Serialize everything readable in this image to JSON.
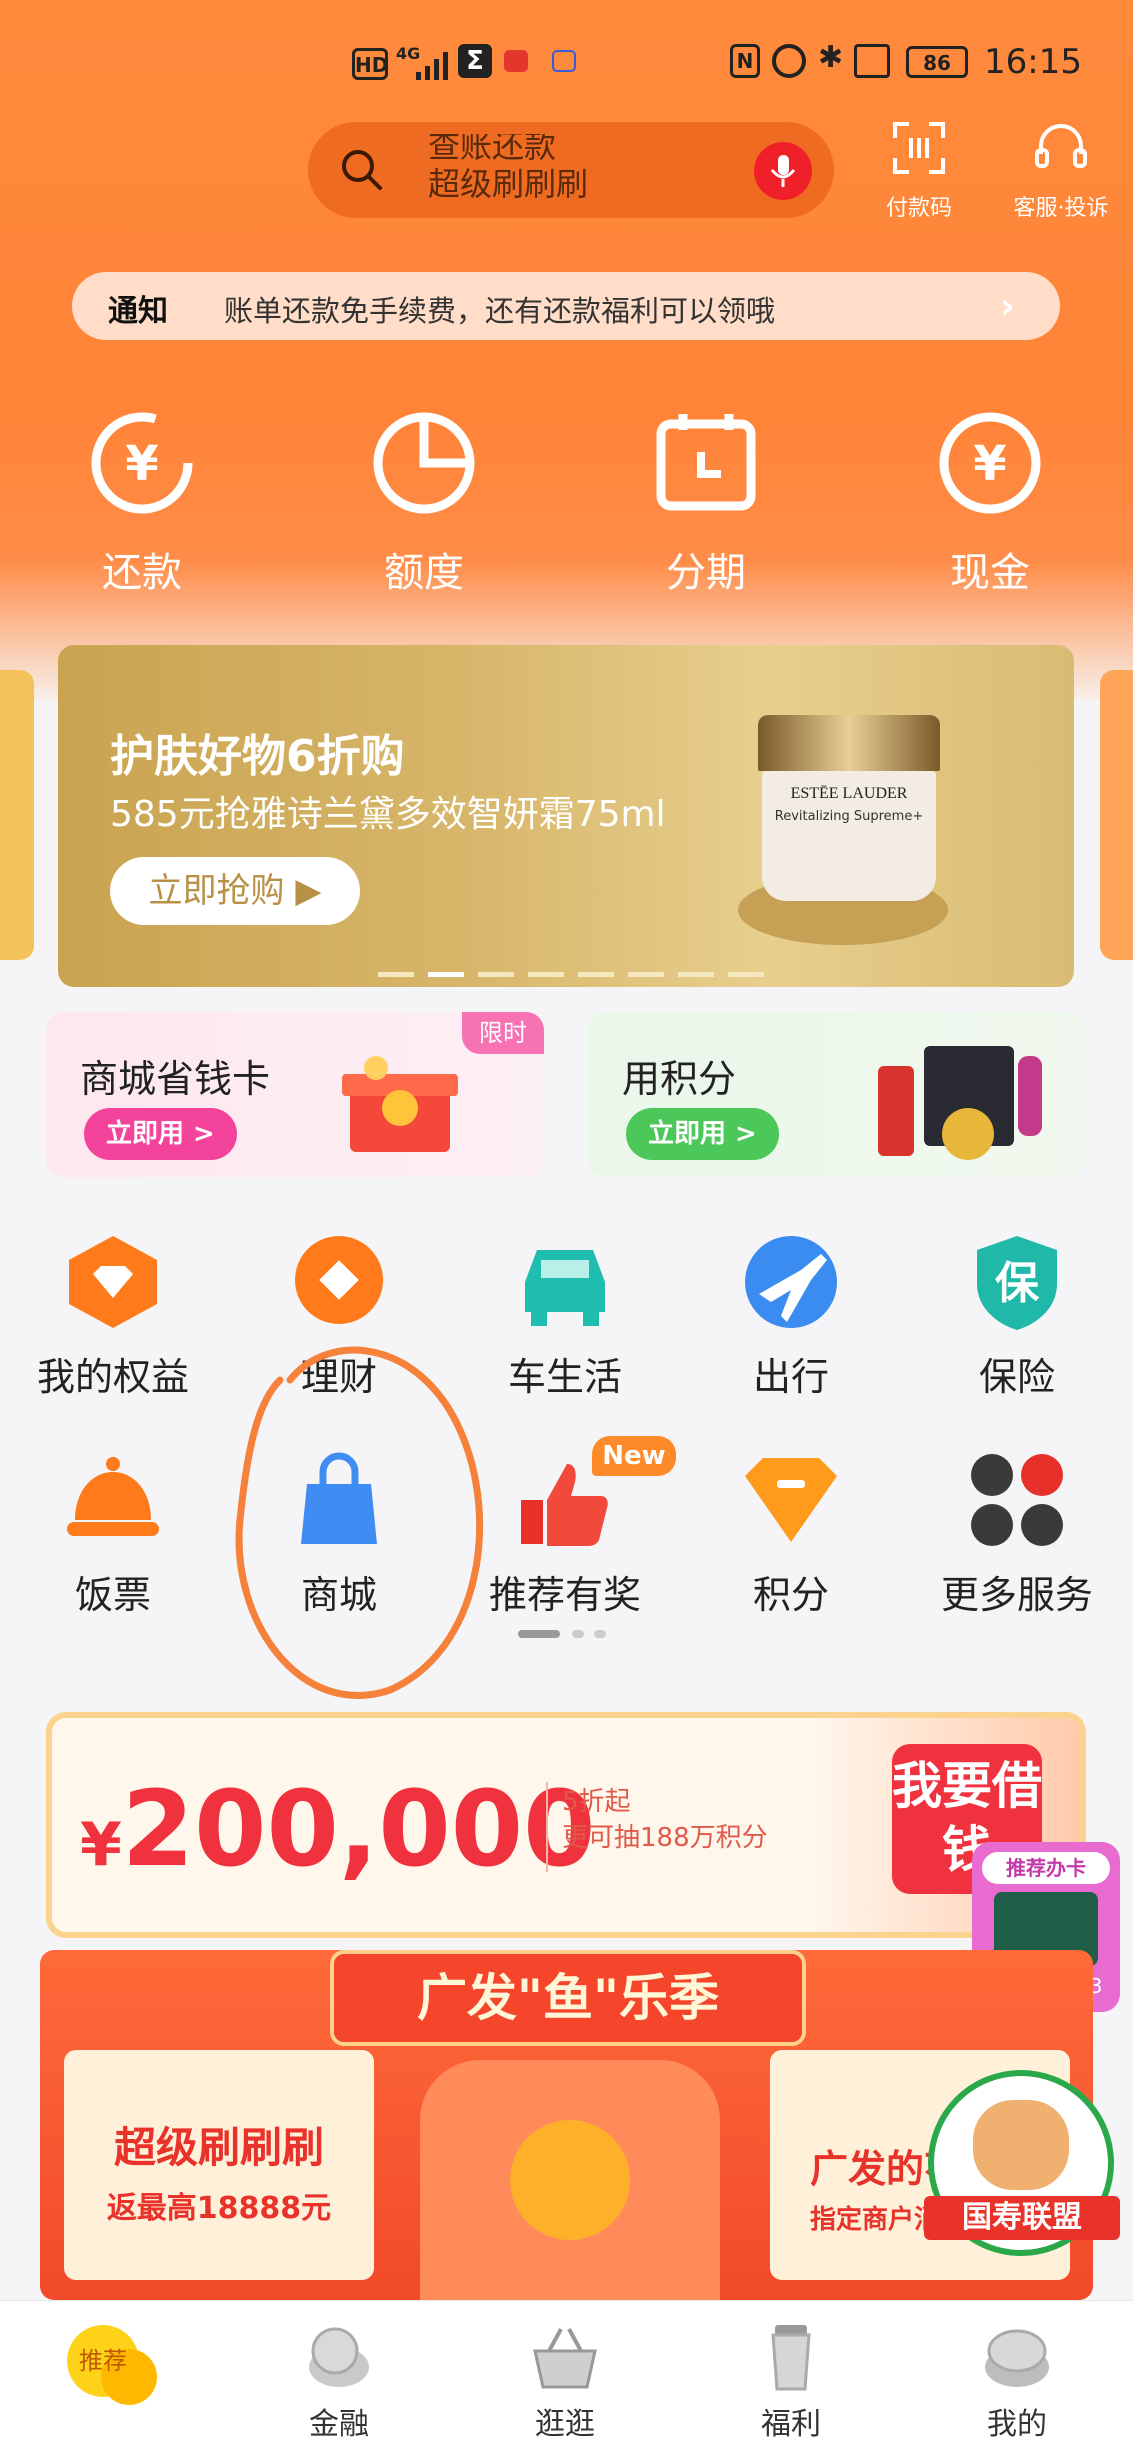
{
  "status_bar": {
    "left": [
      "HD",
      "4G"
    ],
    "battery": "86",
    "time": "16:15"
  },
  "header": {
    "search_text_line1": "查账还款",
    "search_text_line2": "超级刷刷刷",
    "pay_code_label": "付款码",
    "service_label": "客服·投诉"
  },
  "notice": {
    "tag": "通知",
    "text": "账单还款免手续费，还有还款福利可以领哦"
  },
  "quick_actions": [
    {
      "label": "还款",
      "icon": "repay-yen-icon"
    },
    {
      "label": "额度",
      "icon": "pie-chart-icon"
    },
    {
      "label": "分期",
      "icon": "calendar-icon"
    },
    {
      "label": "现金",
      "icon": "cash-yen-icon"
    }
  ],
  "banner": {
    "title": "护肤好物6折购",
    "subtitle": "585元抢雅诗兰黛多效智妍霜75ml",
    "button": "立即抢购",
    "product_brand": "ESTĒE LAUDER",
    "product_name": "Revitalizing Supreme+"
  },
  "promo_cards": [
    {
      "title": "商城省钱卡",
      "button": "立即用 >",
      "badge": "限时"
    },
    {
      "title": "用积分",
      "button": "立即用 >"
    }
  ],
  "services": [
    {
      "label": "我的权益",
      "icon": "benefits-diamond-icon"
    },
    {
      "label": "理财",
      "icon": "wealth-coin-icon"
    },
    {
      "label": "车生活",
      "icon": "car-icon"
    },
    {
      "label": "出行",
      "icon": "plane-icon"
    },
    {
      "label": "保险",
      "icon": "insurance-shield-icon"
    },
    {
      "label": "饭票",
      "icon": "dining-bell-icon"
    },
    {
      "label": "商城",
      "icon": "shopping-bag-icon"
    },
    {
      "label": "推荐有奖",
      "icon": "thumbs-up-icon",
      "badge": "New"
    },
    {
      "label": "积分",
      "icon": "points-gem-icon"
    },
    {
      "label": "更多服务",
      "icon": "more-grid-icon"
    }
  ],
  "loan": {
    "amount": "200,000",
    "currency": "¥",
    "sub_line1": "5折起",
    "sub_line2": "更可抽188万积分",
    "cta": "我要借钱"
  },
  "floating_card": {
    "top": "推荐办卡",
    "bottom": "赢iPhone13"
  },
  "big_promo": {
    "title": "广发\"鱼\"乐季",
    "left_line1": "超级刷刷刷",
    "left_line2": "返最高18888元",
    "right_line1": "广发的花",
    "right_line2": "指定商户消费返",
    "badge": "国寿联盟"
  },
  "bottom_nav": [
    {
      "label": "推荐",
      "icon": "recommend-icon"
    },
    {
      "label": "金融",
      "icon": "finance-coin-icon"
    },
    {
      "label": "逛逛",
      "icon": "basket-icon"
    },
    {
      "label": "福利",
      "icon": "cup-icon"
    },
    {
      "label": "我的",
      "icon": "profile-icon"
    }
  ],
  "colors": {
    "brand_orange": "#ff8a3c",
    "accent_red": "#f0323e"
  }
}
